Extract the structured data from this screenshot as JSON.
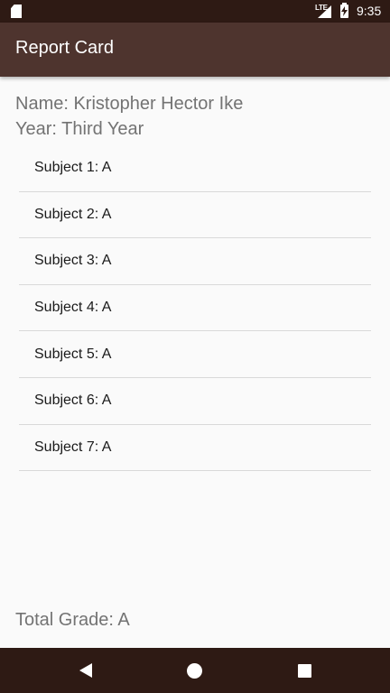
{
  "status_bar": {
    "network": "LTE",
    "time": "9:35"
  },
  "app_bar": {
    "title": "Report Card"
  },
  "student": {
    "name": "Name: Kristopher Hector Ike",
    "year": "Year: Third Year"
  },
  "subjects": [
    "Subject 1: A",
    "Subject 2: A",
    "Subject 3: A",
    "Subject 4: A",
    "Subject 5: A",
    "Subject 6: A",
    "Subject 7: A"
  ],
  "total_grade": "Total Grade: A",
  "icons": {
    "status": [
      "sd-card-icon",
      "signal-icon",
      "battery-charging-icon"
    ],
    "navigation": [
      "back-icon",
      "home-icon",
      "recents-icon"
    ]
  },
  "colors": {
    "status_bar": "#2e1a14",
    "app_bar": "#4e342e",
    "background": "#fafafa",
    "nav_bar": "#2e1a14"
  }
}
